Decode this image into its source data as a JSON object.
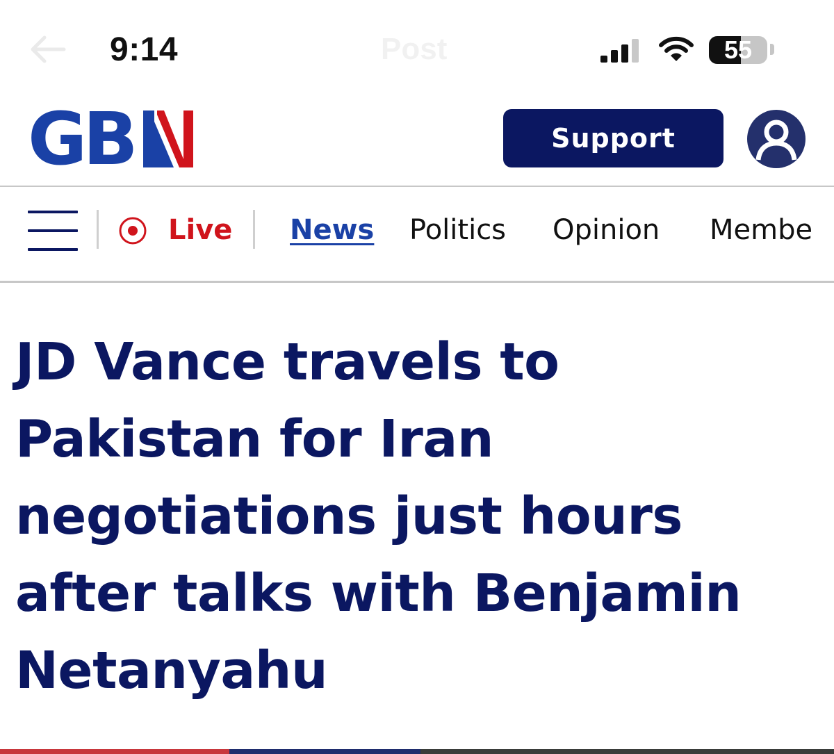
{
  "status_bar": {
    "time": "9:14",
    "faint_title": "Post",
    "battery_level": "55",
    "battery_fraction": 0.55,
    "icons": [
      "back-arrow-icon",
      "cellular-signal-icon",
      "wifi-icon",
      "battery-icon"
    ]
  },
  "header": {
    "logo_text": "GBN",
    "logo_colors": {
      "primary": "#1a41a6",
      "red": "#d0141c"
    },
    "support_label": "Support",
    "support_color": "#0b1761",
    "avatar_icon": "user-avatar-icon"
  },
  "nav": {
    "menu_icon": "hamburger-menu-icon",
    "live_icon": "live-record-icon",
    "live_label": "Live",
    "live_color": "#d0141c",
    "items": [
      {
        "label": "News",
        "active": true
      },
      {
        "label": "Politics",
        "active": false
      },
      {
        "label": "Opinion",
        "active": false
      },
      {
        "label": "Membe",
        "active": false
      }
    ]
  },
  "article": {
    "headline_lines": [
      "JD Vance travels to",
      "Pakistan for Iran",
      "negotiations just hours",
      "after talks with Benjamin",
      "Netanyahu"
    ],
    "headline_color": "#0b1761"
  }
}
